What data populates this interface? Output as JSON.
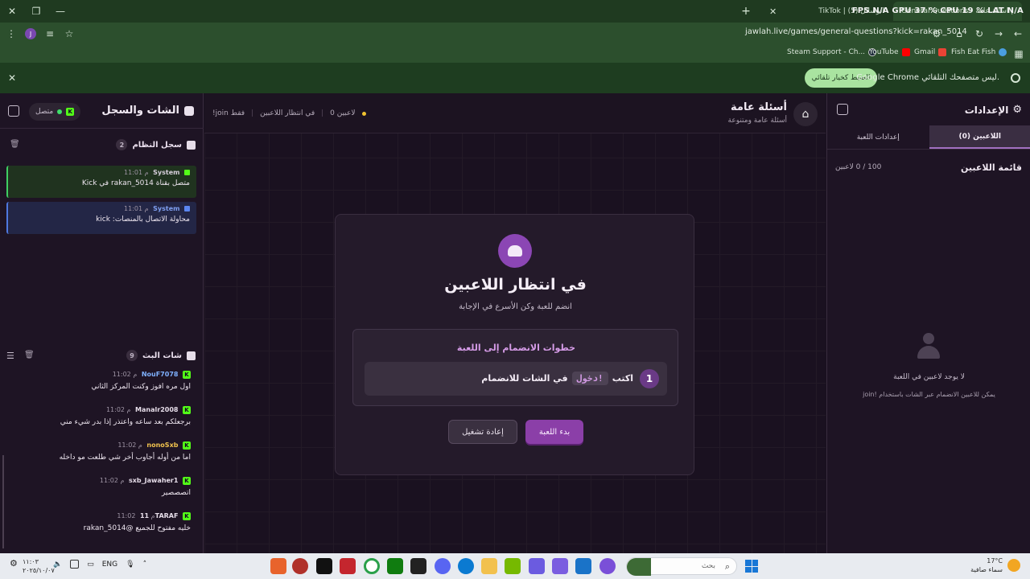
{
  "browser": {
    "tabs": [
      {
        "title": "TikTok | الرسائل (5)"
      },
      {
        "title": "General Questions - جولة | أسئلة عامة"
      }
    ],
    "perf_overlay": "FPS N/A   GPU 37 %   CPU 19 %   LAT N/A",
    "url": "jawlah.live/games/general-questions?kick=rakan_5014",
    "avatar_letter": "J",
    "bookmarks": [
      {
        "label": "Steam Support - Ch...",
        "color": "#1b2838"
      },
      {
        "label": "YouTube",
        "color": "#ff0000"
      },
      {
        "label": "Gmail",
        "color": "#ea4335"
      },
      {
        "label": "Fish Eat Fish",
        "color": "#4a9ee0"
      }
    ],
    "infobar": {
      "text": "Google Chrome ليس متصفحك التلقائي.",
      "button": "الضبط كخيار تلقائي"
    }
  },
  "left_panel": {
    "title": "الشات والسجل",
    "connection": "متصل",
    "system_log": {
      "title": "سجل النظام",
      "count": "2",
      "entries": [
        {
          "sender": "System",
          "time": "11:01 م",
          "message": "متصل بقناة rakan_5014 في Kick",
          "variant": "green"
        },
        {
          "sender": "System",
          "time": "11:01 م",
          "message": "محاولة الاتصال بالمنصات: kick",
          "variant": "blue"
        }
      ]
    },
    "chat": {
      "title": "شات البث",
      "count": "9",
      "messages": [
        {
          "user": "NouF7078",
          "time": "11:02 م",
          "text": "اول مره افوز وكنت المركز الثاني",
          "color": "#7fb1ff"
        },
        {
          "user": "Manalr2008",
          "time": "11:02 م",
          "text": "برجعلكم بعد ساعه واعتذر إذا بدر شيء مني",
          "color": "#e6dde9"
        },
        {
          "user": "nonoSxb",
          "time": "11:02 م",
          "text": "اما من أوله أجاوب أخر شي طلعت مو داخله",
          "color": "#f0c24e"
        },
        {
          "user": "sxb_Jawaher1",
          "time": "11:02 م",
          "text": "اتصصصير",
          "color": "#e6dde9"
        },
        {
          "user": "11TARAF",
          "time": "11:02 م",
          "text": "خليه مفتوح للجميع @rakan_5014",
          "color": "#e6dde9"
        }
      ]
    }
  },
  "center": {
    "title": "أسئلة عامة",
    "subtitle": "أسئلة عامة ومتنوعة",
    "status_players": "0 لاعبين",
    "status_waiting": "في انتظار اللاعبين",
    "status_join": "!join فقط",
    "card": {
      "title": "في انتظار اللاعبين",
      "subtitle": "انضم للعبة وكن الأسرع في الإجابة",
      "steps_title": "خطوات الانضمام إلى اللعبة",
      "step_number": "1",
      "step_prefix": "اكتب",
      "step_command": "!دخول",
      "step_suffix": "في الشات للانضمام",
      "start_button": "بدء اللعبة",
      "reset_button": "إعادة تشغيل"
    }
  },
  "right_panel": {
    "title": "الإعدادات",
    "tab_players": "اللاعبين (0)",
    "tab_settings": "إعدادات اللعبة",
    "list_title": "قائمة اللاعبين",
    "count": "100 / 0 لاعبين",
    "empty_title": "لا يوجد لاعبين في اللعبة",
    "empty_hint": "يمكن للاعبين الانضمام عبر الشات باستخدام !join"
  },
  "taskbar": {
    "search_placeholder": "بحث",
    "weather_temp": "17°C",
    "weather_desc": "سماء صافية",
    "time": "١١:٠٣",
    "date": "٢٠٢٥/١٠/٠٧",
    "lang": "ENG",
    "app_colors": [
      "#b0312a",
      "#b0312a",
      "#111111",
      "#c4262e",
      "#2aa04a",
      "#107c10",
      "#222222",
      "#5865f2",
      "#0b7ad1",
      "#f2c14e",
      "#76b900",
      "#6b5be0",
      "#1a73c8",
      "#7a4fd8"
    ]
  }
}
